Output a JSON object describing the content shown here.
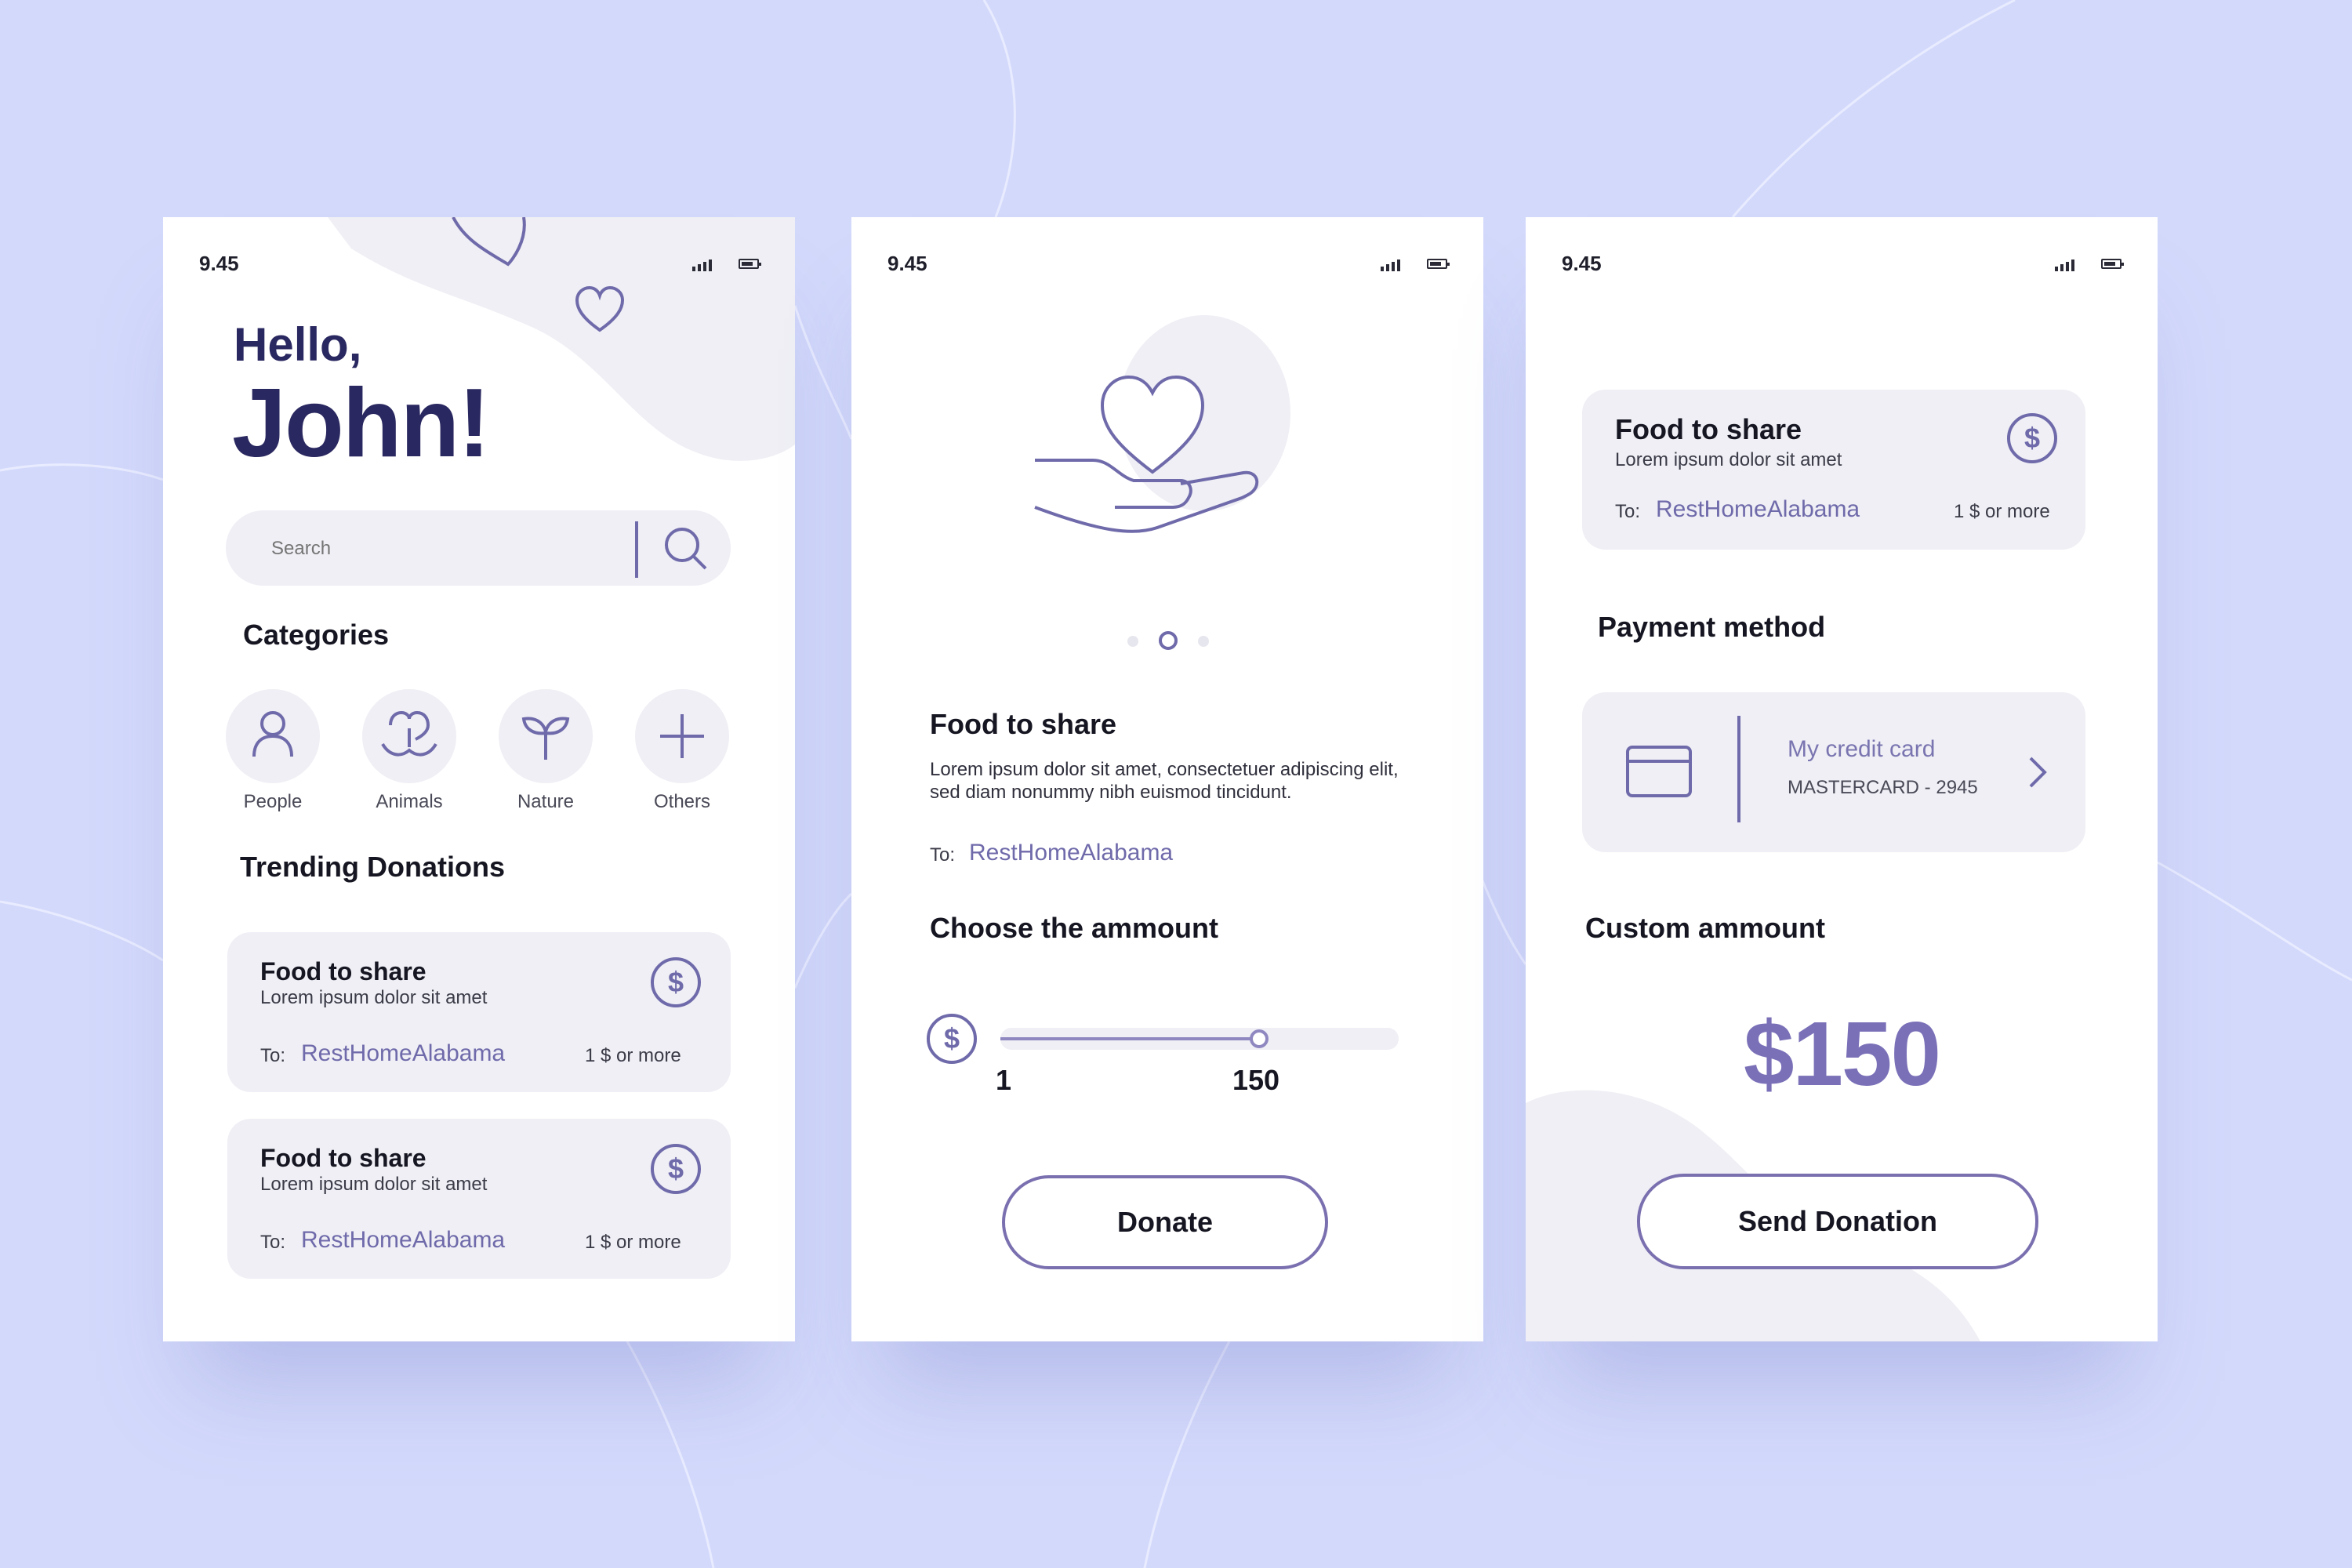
{
  "status": {
    "time": "9.45"
  },
  "home": {
    "greeting_line1": "Hello,",
    "greeting_line2": "John!",
    "search_placeholder": "Search",
    "categories_title": "Categories",
    "categories": [
      {
        "label": "People",
        "icon": "person-icon"
      },
      {
        "label": "Animals",
        "icon": "animal-icon"
      },
      {
        "label": "Nature",
        "icon": "plant-icon"
      },
      {
        "label": "Others",
        "icon": "plus-icon"
      }
    ],
    "trending_title": "Trending Donations",
    "donations": [
      {
        "title": "Food to share",
        "subtitle": "Lorem ipsum dolor sit amet",
        "to_label": "To:",
        "recipient": "RestHomeAlabama",
        "amount_note": "1 $ or more"
      },
      {
        "title": "Food to share",
        "subtitle": "Lorem ipsum dolor sit amet",
        "to_label": "To:",
        "recipient": "RestHomeAlabama",
        "amount_note": "1 $ or more"
      }
    ]
  },
  "detail": {
    "carousel": {
      "count": 3,
      "active": 1
    },
    "title": "Food to share",
    "description": "Lorem ipsum dolor sit amet, consectetuer adipiscing elit, sed diam nonummy nibh euismod tincidunt.",
    "to_label": "To:",
    "recipient": "RestHomeAlabama",
    "choose_title": "Choose the ammount",
    "slider": {
      "min_label": "1",
      "value_label": "150",
      "level": 0.65
    },
    "donate_button": "Donate"
  },
  "payment": {
    "summary": {
      "title": "Food to share",
      "subtitle": "Lorem ipsum dolor sit amet",
      "to_label": "To:",
      "recipient": "RestHomeAlabama",
      "amount_note": "1 $ or more"
    },
    "payment_title": "Payment method",
    "card_name": "My credit card",
    "card_detail": "MASTERCARD - 2945",
    "custom_title": "Custom ammount",
    "custom_value": "$150",
    "send_button": "Send Donation"
  },
  "colors": {
    "background": "#d3d9fb",
    "accent": "#6f6aaa",
    "dark_text": "#161622",
    "card": "#efeff5",
    "greeting": "#2a2860"
  }
}
